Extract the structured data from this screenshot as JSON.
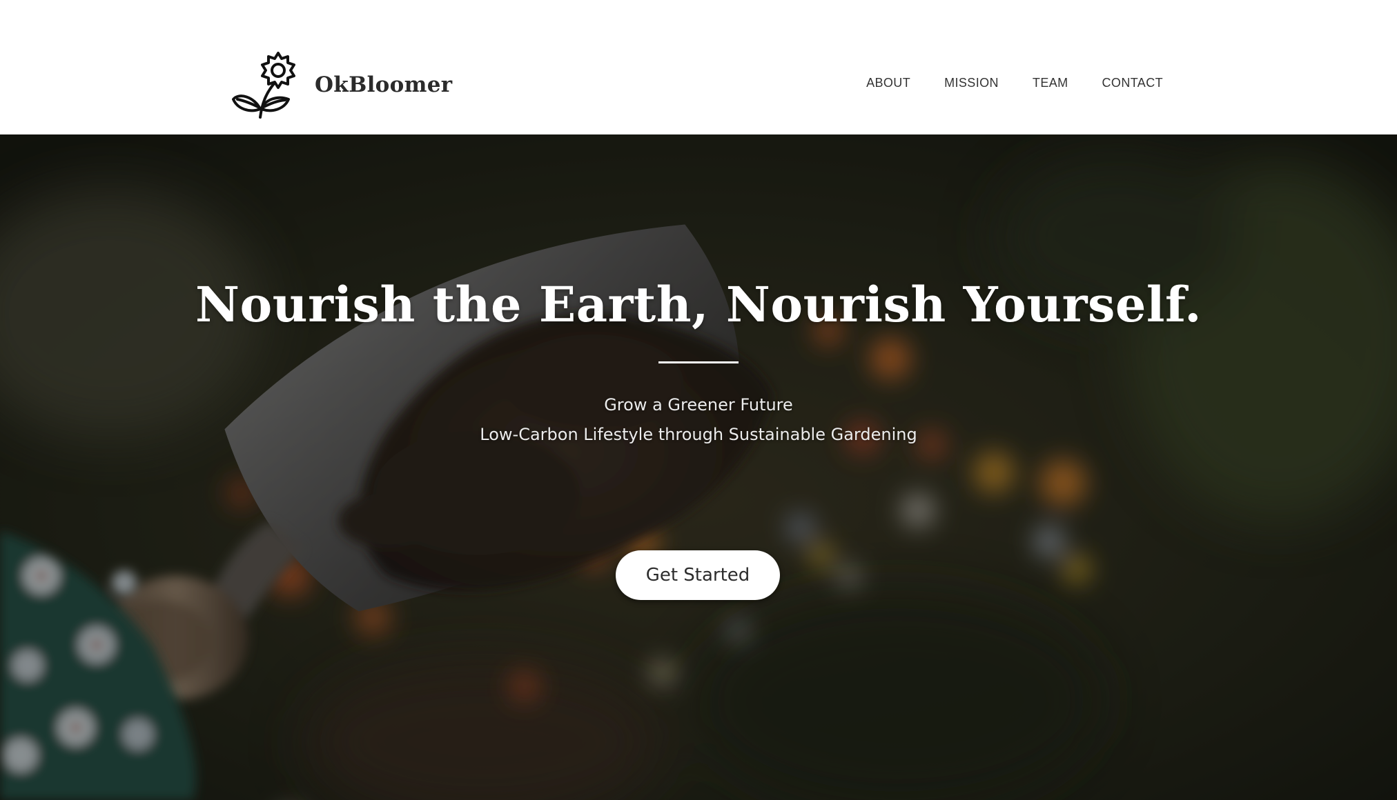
{
  "brand": {
    "name": "OkBloomer",
    "logo_icon": "flower-outline-icon"
  },
  "nav": {
    "items": [
      {
        "label": "ABOUT"
      },
      {
        "label": "MISSION"
      },
      {
        "label": "TEAM"
      },
      {
        "label": "CONTACT"
      }
    ]
  },
  "hero": {
    "title": "Nourish the Earth, Nourish Yourself.",
    "subtitle_line1": "Grow a Greener Future",
    "subtitle_line2": "Low-Carbon Lifestyle through Sustainable Gardening",
    "cta_label": "Get Started",
    "background": "photo-trowel-soil-flowers"
  },
  "colors": {
    "header_bg": "#ffffff",
    "brand_text": "#2b2b2b",
    "nav_text": "#333333",
    "hero_text": "#ffffff",
    "cta_bg": "#ffffff",
    "cta_text": "#2c2c2c"
  }
}
